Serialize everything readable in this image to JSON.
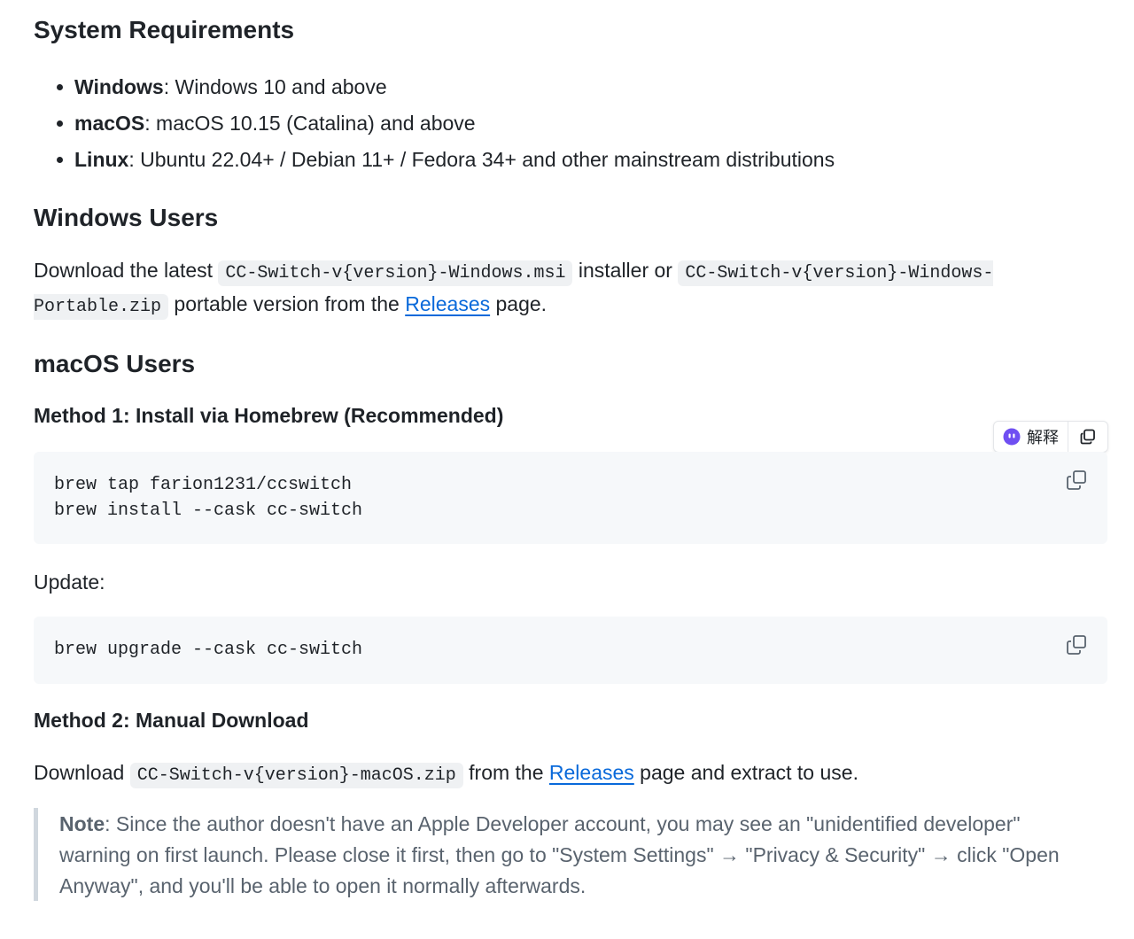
{
  "system_requirements": {
    "heading": "System Requirements",
    "items": [
      {
        "os": "Windows",
        "sep": ": ",
        "desc": "Windows 10 and above"
      },
      {
        "os": "macOS",
        "sep": ": ",
        "desc": "macOS 10.15 (Catalina) and above"
      },
      {
        "os": "Linux",
        "sep": ": ",
        "desc": "Ubuntu 22.04+ / Debian 11+ / Fedora 34+ and other mainstream distributions"
      }
    ]
  },
  "windows_users": {
    "heading": "Windows Users",
    "text_1": "Download the latest ",
    "code_1": "CC-Switch-v{version}-Windows.msi",
    "text_2": " installer or ",
    "code_2": "CC-Switch-v{version}-Windows-Portable.zip",
    "text_3": " portable version from the ",
    "link": "Releases",
    "text_4": " page."
  },
  "macos_users": {
    "heading": "macOS Users",
    "method1": {
      "heading": "Method 1: Install via Homebrew (Recommended)",
      "code": "brew tap farion1231/ccswitch\nbrew install --cask cc-switch"
    },
    "update": {
      "label": "Update:",
      "code": "brew upgrade --cask cc-switch"
    },
    "method2": {
      "heading": "Method 2: Manual Download",
      "text_1": "Download ",
      "code": "CC-Switch-v{version}-macOS.zip",
      "text_2": " from the ",
      "link": "Releases",
      "text_3": " page and extract to use."
    },
    "note": {
      "label": "Note",
      "text": ": Since the author doesn't have an Apple Developer account, you may see an \"unidentified developer\" warning on first launch. Please close it first, then go to \"System Settings\" → \"Privacy & Security\" → click \"Open Anyway\", and you'll be able to open it normally afterwards."
    }
  },
  "toolbar": {
    "explain_label": "解释"
  },
  "icons": {
    "copy": "copy-icon",
    "explain": "assistant-icon"
  },
  "colors": {
    "link": "#0969da",
    "code_bg": "#f6f8fa",
    "inline_code_bg": "#eff1f3",
    "quote_bar": "#d0d7de",
    "quote_text": "#59636e",
    "assistant": "#6f4ff2"
  }
}
